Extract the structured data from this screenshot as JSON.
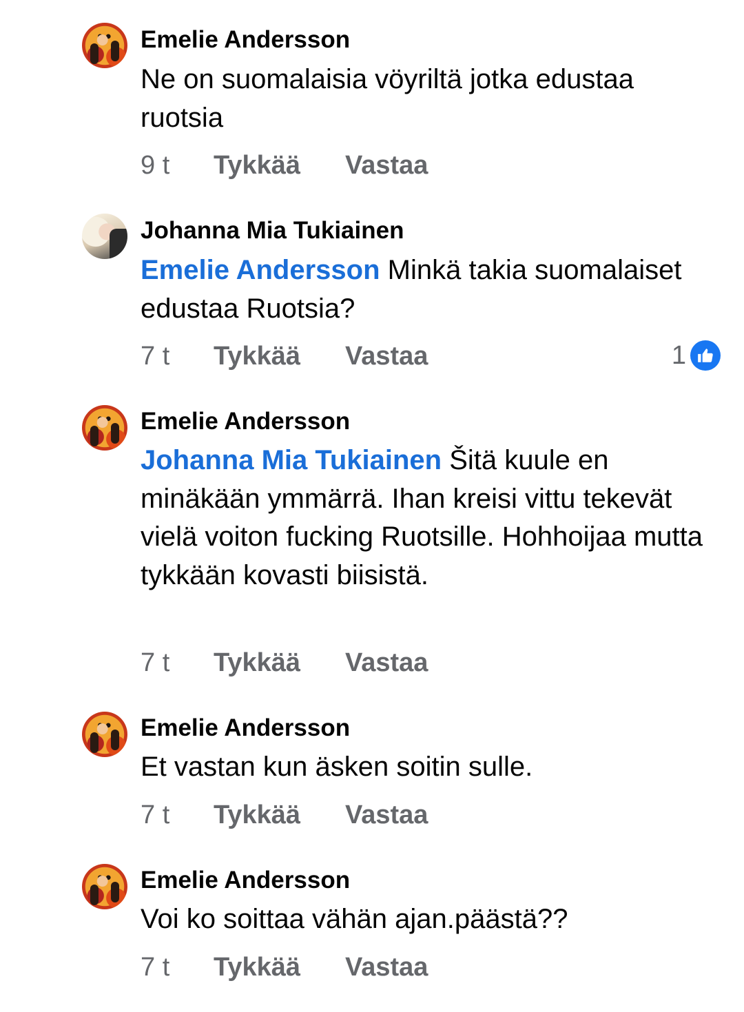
{
  "comments": [
    {
      "author": "Emelie Andersson",
      "mention": "",
      "text": "Ne on suomalaisia vöyriltä jotka edustaa ruotsia",
      "time": "9 t",
      "like_label": "Tykkää",
      "reply_label": "Vastaa"
    },
    {
      "author": "Johanna Mia Tukiainen",
      "mention": "Emelie Andersson",
      "text": " Minkä takia suomalaiset edustaa Ruotsia?",
      "time": "7 t",
      "like_label": "Tykkää",
      "reply_label": "Vastaa",
      "reaction_count": "1",
      "reaction_icon": "thumbs-up-icon",
      "reaction_color": "#1877f2"
    },
    {
      "author": "Emelie Andersson",
      "mention": "Johanna Mia Tukiainen",
      "text": " Šitä kuule en minäkään ymmärrä. Ihan kreisi vittu tekevät vielä voiton fucking Ruotsille. Hohhoijaa mutta tykkään kovasti biisistä.",
      "time": "7 t",
      "like_label": "Tykkää",
      "reply_label": "Vastaa"
    },
    {
      "author": "Emelie Andersson",
      "mention": "",
      "text": "Et vastan kun äsken soitin sulle.",
      "time": "7 t",
      "like_label": "Tykkää",
      "reply_label": "Vastaa"
    },
    {
      "author": "Emelie Andersson",
      "mention": "",
      "text": "Voi ko soittaa vähän ajan.päästä??",
      "time": "7 t",
      "like_label": "Tykkää",
      "reply_label": "Vastaa"
    }
  ],
  "colors": {
    "mention": "#1a6ed8",
    "meta_text": "#65676b",
    "like_badge": "#1877f2"
  }
}
